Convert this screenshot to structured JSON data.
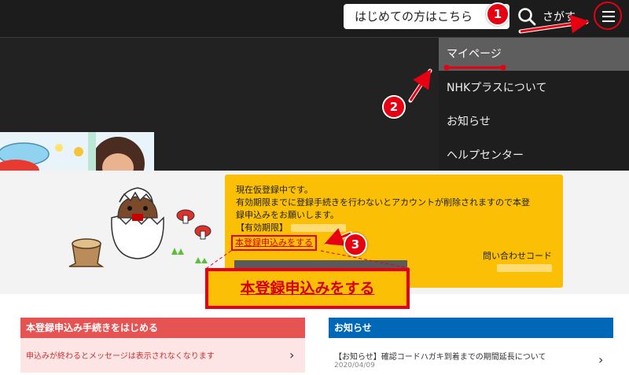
{
  "header": {
    "welcome_label": "はじめての方はこちら",
    "search_label": "さがす",
    "search_icon": "search-icon",
    "menu_icon": "hamburger-menu-icon"
  },
  "side_menu": {
    "items": [
      {
        "label": "マイページ",
        "active": true
      },
      {
        "label": "NHKプラスについて",
        "active": false
      },
      {
        "label": "お知らせ",
        "active": false
      },
      {
        "label": "ヘルプセンター",
        "active": false
      }
    ]
  },
  "notice": {
    "line1": "現在仮登録中です。",
    "line2": "有効期限までに登録手続きを行わないとアカウントが削除されますので本登",
    "line3": "録申込みをお願いします。",
    "period_label": "【有効期限】",
    "link_label": "本登録申込みをする",
    "contact_label": "問い合わせコード"
  },
  "callout": {
    "label": "本登録申込みをする"
  },
  "cards": {
    "registration": {
      "header": "本登録申込み手続きをはじめる",
      "text": "申込みが終わるとメッセージは表示されなくなります"
    },
    "news": {
      "header": "お知らせ",
      "title": "【お知らせ】確認コードハガキ到着までの期間延長について",
      "date": "2020/04/09"
    }
  },
  "annotations": {
    "badges": [
      "1",
      "2",
      "3"
    ]
  },
  "colors": {
    "accent_red": "#e60012",
    "notice_yellow": "#fbbf06",
    "news_blue": "#0068b7",
    "reg_red": "#e55353"
  }
}
